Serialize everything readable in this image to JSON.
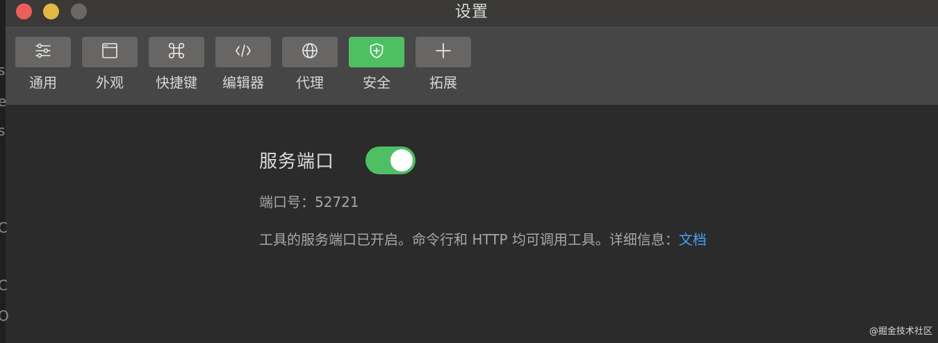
{
  "window": {
    "title": "设置"
  },
  "left_edge_glyphs": [
    "s",
    "e",
    "s",
    "C",
    "C",
    "O"
  ],
  "toolbar": {
    "items": [
      {
        "label": "通用",
        "icon": "sliders-icon",
        "active": false
      },
      {
        "label": "外观",
        "icon": "window-icon",
        "active": false
      },
      {
        "label": "快捷键",
        "icon": "command-icon",
        "active": false
      },
      {
        "label": "编辑器",
        "icon": "code-icon",
        "active": false
      },
      {
        "label": "代理",
        "icon": "globe-icon",
        "active": false
      },
      {
        "label": "安全",
        "icon": "shield-plus-icon",
        "active": true
      },
      {
        "label": "拓展",
        "icon": "plus-icon",
        "active": false
      }
    ]
  },
  "security": {
    "service_label": "服务端口",
    "toggle_on": true,
    "port_label": "端口号：",
    "port_value": "52721",
    "description": "工具的服务端口已开启。命令行和 HTTP 均可调用工具。详细信息：",
    "doc_link": "文档"
  },
  "watermark": "@掘金技术社区",
  "colors": {
    "accent_green": "#4fbf64",
    "link_blue": "#4a9df8",
    "toolbar_bg": "#474646",
    "content_bg": "#2b2b2b"
  }
}
